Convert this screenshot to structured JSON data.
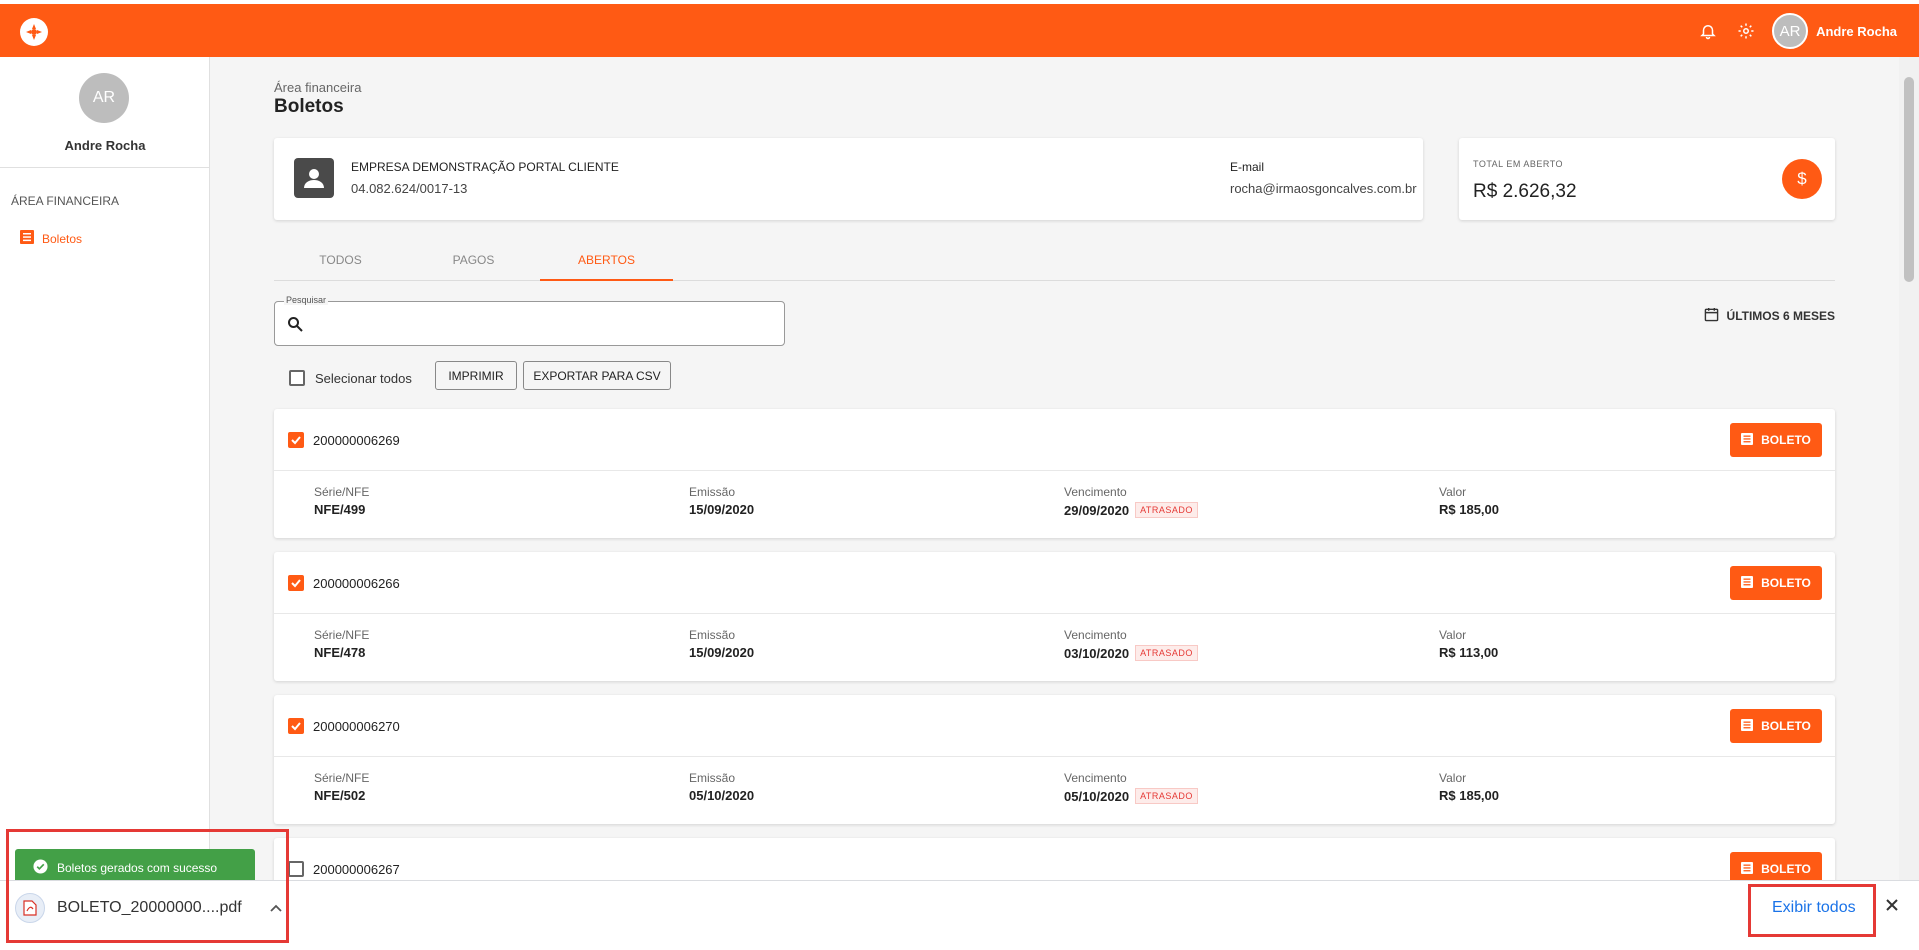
{
  "header": {
    "logo_icon": "flower-logo-icon",
    "bell_icon": "bell-icon",
    "gear_icon": "gear-icon",
    "avatar_initials": "AR",
    "user_name": "Andre Rocha",
    "accent_color": "#ff5a14"
  },
  "sidebar": {
    "avatar_initials": "AR",
    "user_name": "Andre Rocha",
    "section_title": "ÁREA FINANCEIRA",
    "items": [
      {
        "label": "Boletos",
        "icon": "list-icon"
      }
    ]
  },
  "page": {
    "breadcrumb": "Área financeira",
    "title": "Boletos"
  },
  "company": {
    "name": "EMPRESA DEMONSTRAÇÃO PORTAL CLIENTE",
    "document": "04.082.624/0017-13",
    "email_label": "E-mail",
    "email": "rocha@irmaosgoncalves.com.br"
  },
  "total": {
    "label": "TOTAL EM ABERTO",
    "value": "R$ 2.626,32",
    "icon": "dollar-icon"
  },
  "tabs": [
    {
      "label": "TODOS",
      "active": false
    },
    {
      "label": "PAGOS",
      "active": false
    },
    {
      "label": "ABERTOS",
      "active": true
    }
  ],
  "search": {
    "label": "Pesquisar",
    "value": "",
    "placeholder": ""
  },
  "period": {
    "label": "ÚLTIMOS 6 MESES",
    "icon": "calendar-icon"
  },
  "actions": {
    "select_all_label": "Selecionar todos",
    "print_label": "IMPRIMIR",
    "export_label": "EXPORTAR PARA CSV"
  },
  "labels": {
    "serie": "Série/NFE",
    "emissao": "Emissão",
    "vencimento": "Vencimento",
    "valor": "Valor",
    "late_badge": "ATRASADO",
    "boleto_button": "BOLETO"
  },
  "boletos": [
    {
      "number": "200000006269",
      "checked": true,
      "serie": "NFE/499",
      "emissao": "15/09/2020",
      "vencimento": "29/09/2020",
      "late": true,
      "valor": "R$ 185,00"
    },
    {
      "number": "200000006266",
      "checked": true,
      "serie": "NFE/478",
      "emissao": "15/09/2020",
      "vencimento": "03/10/2020",
      "late": true,
      "valor": "R$ 113,00"
    },
    {
      "number": "200000006270",
      "checked": true,
      "serie": "NFE/502",
      "emissao": "05/10/2020",
      "vencimento": "05/10/2020",
      "late": true,
      "valor": "R$ 185,00"
    },
    {
      "number": "200000006267",
      "checked": false
    }
  ],
  "toast": {
    "message": "Boletos gerados com sucesso",
    "icon": "check-circle-icon",
    "color": "#43a047"
  },
  "downloads": {
    "file_name": "BOLETO_20000000....pdf",
    "file_icon": "pdf-file-icon",
    "show_all_label": "Exibir todos",
    "close_icon": "close-icon"
  }
}
